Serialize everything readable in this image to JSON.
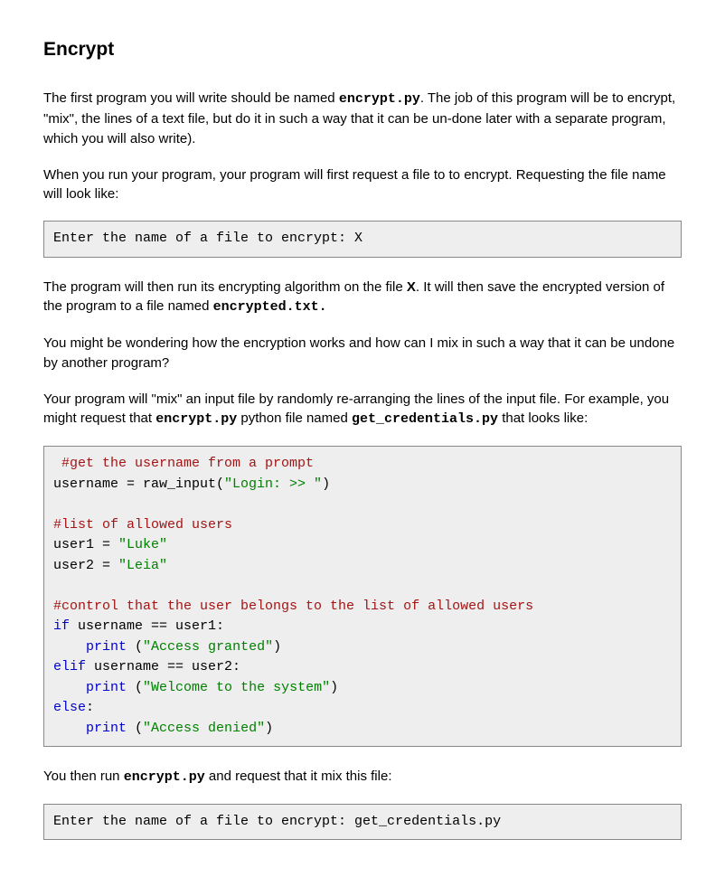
{
  "heading": "Encrypt",
  "p1_a": "The first program you will write should be named ",
  "p1_code1": "encrypt.py",
  "p1_b": ". The job of this program will be to encrypt, \"mix\", the lines of a text file, but do it in such a way that it can be un-done later with a separate program, which you  will also write).",
  "p2": "When you run your program, your program will first request a file to to encrypt. Requesting the file name will look like:",
  "codebox1": "Enter the name of a file to encrypt: X",
  "p3_a": "The program will then run its encrypting algorithm on the file ",
  "p3_bold": "X",
  "p3_b": ". It will then save the encrypted version of the program to a file named ",
  "p3_code": "encrypted.txt.",
  "p4": "You might be wondering how the encryption works and how can I mix in such a way that it can be undone by another program?",
  "p5_a": "Your program will \"mix\" an input file by randomly re-arranging the lines of the input file. For example, you might request that ",
  "p5_code1": "encrypt.py",
  "p5_b": " python file named ",
  "p5_code2": "get_credentials.py",
  "p5_c": " that looks like:",
  "code2": {
    "l1_comment": " #get the username from a prompt",
    "l2_a": "username = raw_input(",
    "l2_str": "\"Login: >> \"",
    "l2_b": ")",
    "l4_comment": "#list of allowed users",
    "l5_a": "user1 = ",
    "l5_str": "\"Luke\"",
    "l6_a": "user2 = ",
    "l6_str": "\"Leia\"",
    "l8_comment": "#control that the user belongs to the list of allowed users",
    "l9_kw": "if",
    "l9_rest": " username == user1:",
    "l10_indent": "    ",
    "l10_kw": "print",
    "l10_a": " (",
    "l10_str": "\"Access granted\"",
    "l10_b": ")",
    "l11_kw": "elif",
    "l11_rest": " username == user2:",
    "l12_indent": "    ",
    "l12_kw": "print",
    "l12_a": " (",
    "l12_str": "\"Welcome to the system\"",
    "l12_b": ")",
    "l13_kw": "else",
    "l13_rest": ":",
    "l14_indent": "    ",
    "l14_kw": "print",
    "l14_a": " (",
    "l14_str": "\"Access denied\"",
    "l14_b": ")"
  },
  "p6_a": "You then run ",
  "p6_code": "encrypt.py",
  "p6_b": " and request that it mix this file:",
  "codebox3": "Enter the name of a file to encrypt: get_credentials.py"
}
